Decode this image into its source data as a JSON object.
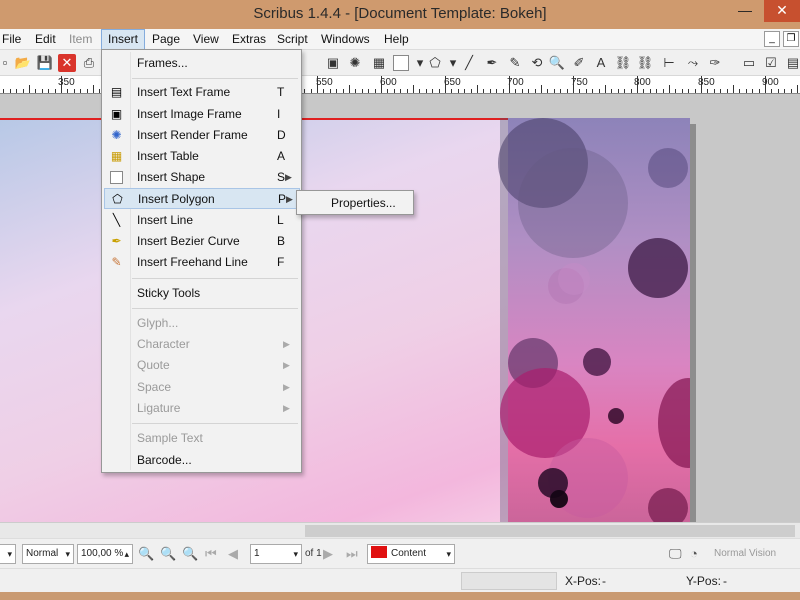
{
  "window": {
    "title": "Scribus 1.4.4 - [Document Template: Bokeh]",
    "minimize": "—",
    "close": "✕"
  },
  "menubar": {
    "items": [
      "File",
      "Edit",
      "Item",
      "Insert",
      "Page",
      "View",
      "Extras",
      "Script",
      "Windows",
      "Help"
    ],
    "active": "Insert"
  },
  "ruler": {
    "labels": [
      "350",
      "550",
      "600",
      "650",
      "700",
      "750",
      "800",
      "850",
      "900"
    ]
  },
  "insert_menu": {
    "frames": "Frames...",
    "text_frame": {
      "label": "Insert Text Frame",
      "shortcut": "T"
    },
    "image_frame": {
      "label": "Insert Image Frame",
      "shortcut": "I"
    },
    "render_frame": {
      "label": "Insert Render Frame",
      "shortcut": "D"
    },
    "table": {
      "label": "Insert Table",
      "shortcut": "A"
    },
    "shape": {
      "label": "Insert Shape",
      "shortcut": "S"
    },
    "polygon": {
      "label": "Insert Polygon",
      "shortcut": "P"
    },
    "line": {
      "label": "Insert Line",
      "shortcut": "L"
    },
    "bezier": {
      "label": "Insert Bezier Curve",
      "shortcut": "B"
    },
    "freehand": {
      "label": "Insert Freehand Line",
      "shortcut": "F"
    },
    "sticky_tools": "Sticky Tools",
    "glyph": "Glyph...",
    "character": "Character",
    "quote": "Quote",
    "space": "Space",
    "ligature": "Ligature",
    "sample_text": "Sample Text",
    "barcode": "Barcode..."
  },
  "polygon_submenu": {
    "properties": "Properties..."
  },
  "statusbar": {
    "mode": "Normal",
    "zoom": "100,00 %",
    "page": "1",
    "of_pages": "of 1",
    "layer": "Content",
    "vision": "Normal Vision",
    "xpos_label": "X-Pos:",
    "xpos_value": "-",
    "ypos_label": "Y-Pos:",
    "ypos_value": "-"
  },
  "colors": {
    "titlebar": "#cf9a6e",
    "highlight": "#d8e6f2",
    "layer_swatch": "#e01010"
  }
}
